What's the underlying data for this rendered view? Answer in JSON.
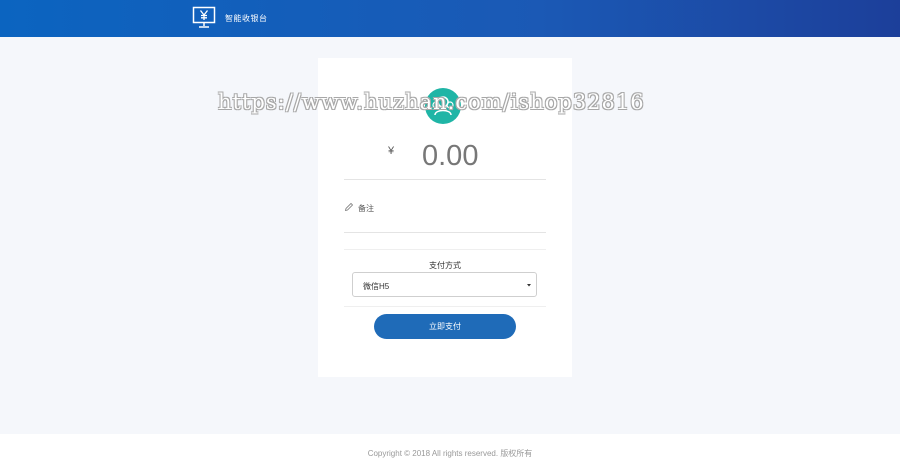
{
  "header": {
    "brand_icon": "monitor-yen-icon",
    "brand_text": "智能收银台"
  },
  "card": {
    "avatar_icon": "user-group-icon",
    "currency_symbol": "¥",
    "amount": "0.00",
    "note_icon": "pencil-icon",
    "note_label": "备注",
    "payment_method_label": "支付方式",
    "payment_method_selected": "微信H5",
    "pay_button_label": "立即支付"
  },
  "footer": {
    "copyright": "Copyright © 2018 All rights reserved. 版权所有"
  },
  "watermark": {
    "text": "https://www.huzhan.com/ishop32816"
  },
  "colors": {
    "header_start": "#0b64c0",
    "header_end": "#1c3f9a",
    "avatar": "#1fb5a6",
    "button": "#1f6bb8",
    "page_bg": "#f5f7fb"
  }
}
